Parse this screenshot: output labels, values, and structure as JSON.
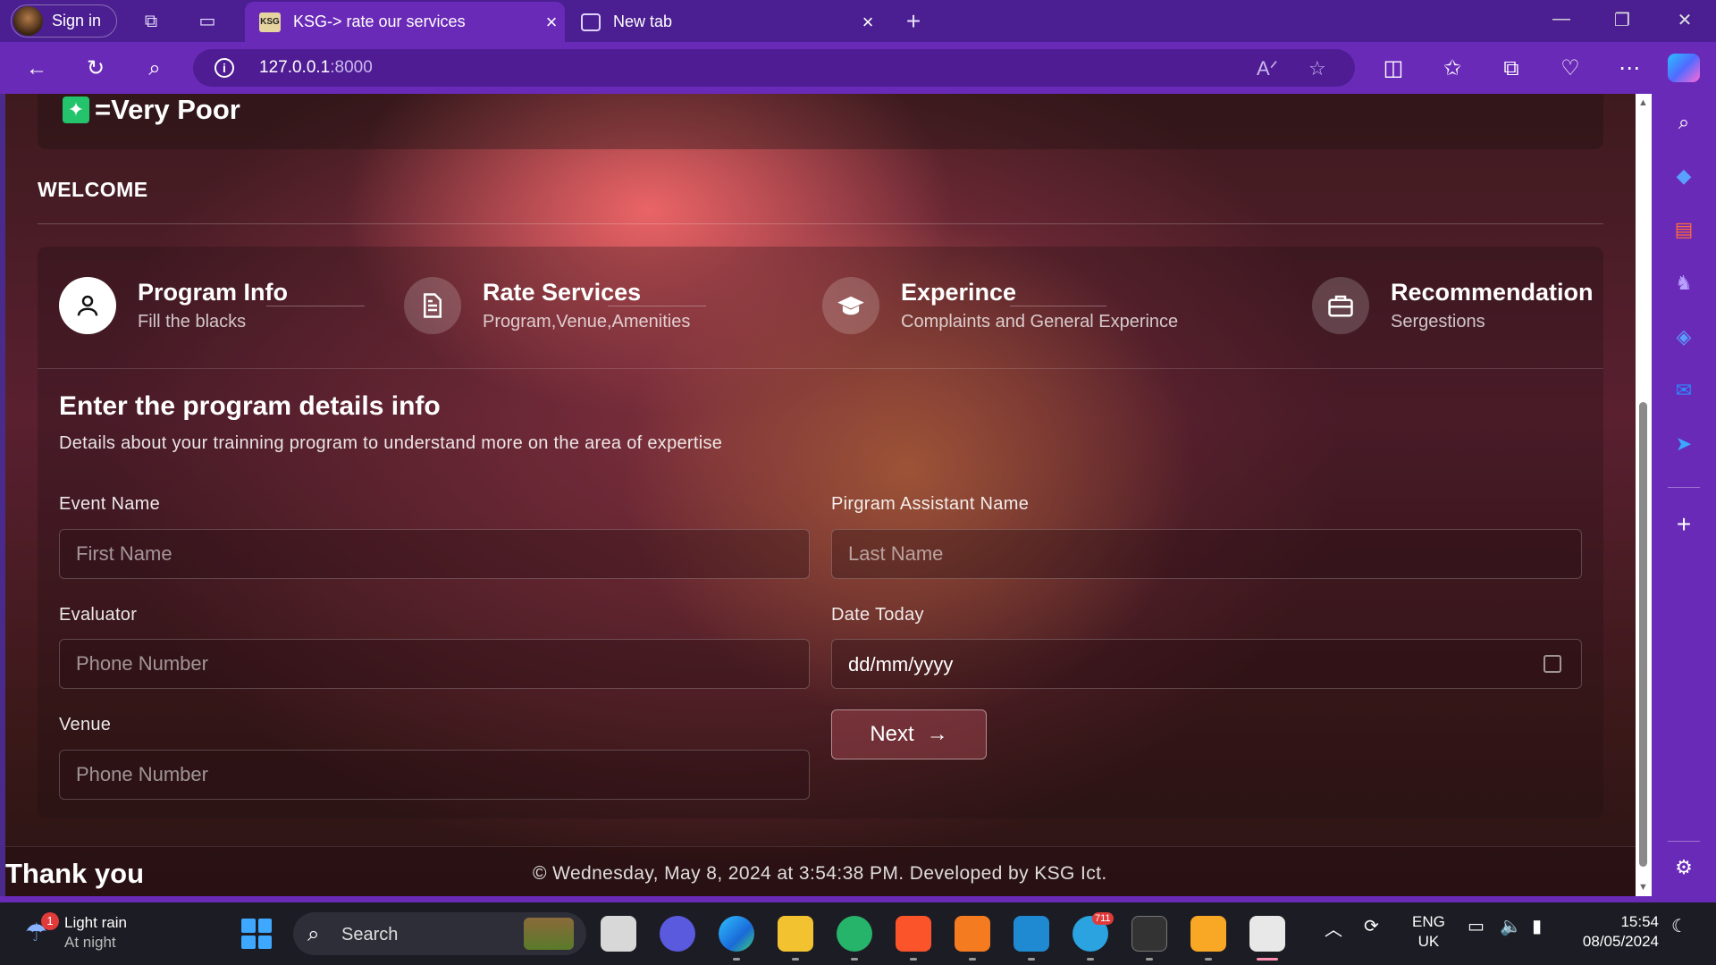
{
  "browser": {
    "signin_label": "Sign in",
    "tabs": [
      {
        "label": "KSG-> rate our services",
        "favicon": "KSG"
      },
      {
        "label": "New tab"
      }
    ],
    "url_host": "127.0.0.1",
    "url_port": ":8000"
  },
  "page": {
    "rating_text": "=Very Poor",
    "welcome": "WELCOME",
    "steps": [
      {
        "title": "Program Info",
        "subtitle": "Fill the blacks",
        "icon": "user-icon"
      },
      {
        "title": "Rate Services",
        "subtitle": "Program,Venue,Amenities",
        "icon": "document-icon"
      },
      {
        "title": "Experince",
        "subtitle": "Complaints and General Experince",
        "icon": "graduation-cap-icon"
      },
      {
        "title": "Recommendation",
        "subtitle": "Sergestions",
        "icon": "briefcase-icon"
      }
    ],
    "form": {
      "title": "Enter the program details info",
      "subtitle": "Details about your trainning program to understand more on the area of expertise",
      "event_name_label": "Event Name",
      "event_name_placeholder": "First Name",
      "assistant_label": "Pirgram Assistant Name",
      "assistant_placeholder": "Last Name",
      "evaluator_label": "Evaluator",
      "evaluator_placeholder": "Phone Number",
      "date_label": "Date Today",
      "date_value": "dd/mm/yyyy",
      "venue_label": "Venue",
      "venue_placeholder": "Phone Number",
      "next_label": "Next"
    },
    "footer": {
      "thanks": "Thank you",
      "copyright": "© Wednesday, May 8, 2024 at 3:54:38 PM. Developed by KSG Ict."
    }
  },
  "taskbar": {
    "weather_line1": "Light rain",
    "weather_line2": "At night",
    "weather_badge": "1",
    "search_label": "Search",
    "lang_line1": "ENG",
    "lang_line2": "UK",
    "time": "15:54",
    "date": "08/05/2024",
    "telegram_badge": "711"
  }
}
